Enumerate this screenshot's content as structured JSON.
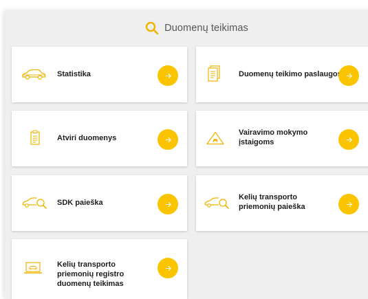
{
  "header": {
    "title": "Duomenų teikimas",
    "icon": "search-icon"
  },
  "colors": {
    "accent": "#fbc400",
    "icon": "#f0b400"
  },
  "cards": [
    {
      "label": "Statistika",
      "icon": "car-icon"
    },
    {
      "label": "Duomenų teikimo paslaugos",
      "icon": "document-icon"
    },
    {
      "label": "Atviri duomenys",
      "icon": "clipboard-icon"
    },
    {
      "label": "Vairavimo mokymo įstaigoms",
      "icon": "warning-triangle-icon"
    },
    {
      "label": "SDK paieška",
      "icon": "car-search-icon"
    },
    {
      "label": "Kelių transporto priemonių paieška",
      "icon": "car-search-icon"
    },
    {
      "label": "Kelių transporto priemonių registro duomenų teikimas",
      "icon": "laptop-car-icon"
    }
  ]
}
